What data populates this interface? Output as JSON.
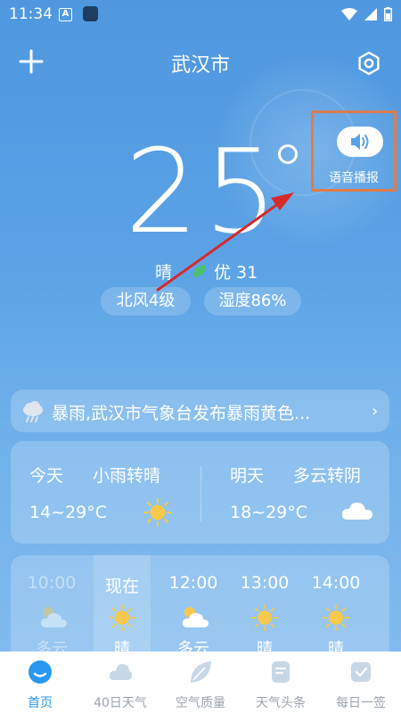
{
  "status_bar": {
    "time": "11:34"
  },
  "header": {
    "city": "武汉市"
  },
  "voice": {
    "label": "语音播报"
  },
  "current": {
    "temperature": "25",
    "condition": "晴",
    "aqi": "优 31",
    "wind": "北风4级",
    "humidity": "湿度86%"
  },
  "alert": {
    "text": "暴雨,武汉市气象台发布暴雨黄色..."
  },
  "forecast": {
    "today": {
      "label": "今天",
      "condition": "小雨转晴",
      "range": "14~29°C"
    },
    "tomorrow": {
      "label": "明天",
      "condition": "多云转阴",
      "range": "18~29°C"
    }
  },
  "hourly": [
    {
      "time": "10:00",
      "condition": "多云",
      "icon": "partly-cloudy-icon"
    },
    {
      "time": "现在",
      "condition": "晴",
      "icon": "sun-icon"
    },
    {
      "time": "12:00",
      "condition": "多云",
      "icon": "partly-cloudy-icon"
    },
    {
      "time": "13:00",
      "condition": "晴",
      "icon": "sun-icon"
    },
    {
      "time": "14:00",
      "condition": "晴",
      "icon": "sun-icon"
    }
  ],
  "nav": [
    {
      "label": "首页",
      "icon": "home-icon",
      "active": true
    },
    {
      "label": "40日天气",
      "icon": "calendar-cloud-icon",
      "active": false
    },
    {
      "label": "空气质量",
      "icon": "leaf-icon",
      "active": false
    },
    {
      "label": "天气头条",
      "icon": "news-icon",
      "active": false
    },
    {
      "label": "每日一签",
      "icon": "daily-card-icon",
      "active": false
    }
  ],
  "colors": {
    "accent": "#2a98f0",
    "highlight_box": "#e07b4a",
    "annotation_arrow": "#d62a2a"
  }
}
